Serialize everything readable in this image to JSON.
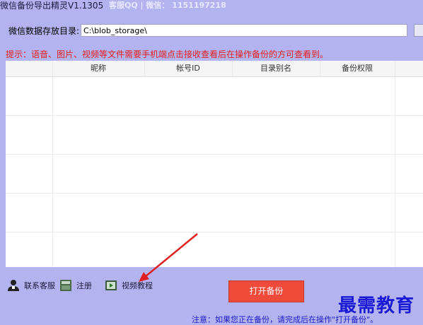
{
  "titlebar": {
    "app_title": "微信备份导出精灵V1.1305",
    "contact": "客服QQ | 微信： 1151197218"
  },
  "path": {
    "label": "微信数据存放目录:",
    "value": "C:\\blob_storage\\"
  },
  "tip": "提示：语音、图片、视频等文件需要手机端点击接收查看后在操作备份的方可查看到。",
  "table": {
    "columns": [
      "昵称",
      "帐号ID",
      "目录别名",
      "备份权限"
    ]
  },
  "footer": {
    "contact_support": "联系客服",
    "register": "注册",
    "video_tutorial": "视频教程",
    "open_backup": "打开备份"
  },
  "note": "注意：如果您正在备份，请完成后在操作\"打开备份\"。",
  "watermark": "最需教育",
  "colors": {
    "background": "#b3b3f0",
    "tip_text": "#e41e1e",
    "primary_button": "#f04a3a",
    "note_text": "#1a1ac8",
    "annotation_arrow": "#e02020"
  }
}
